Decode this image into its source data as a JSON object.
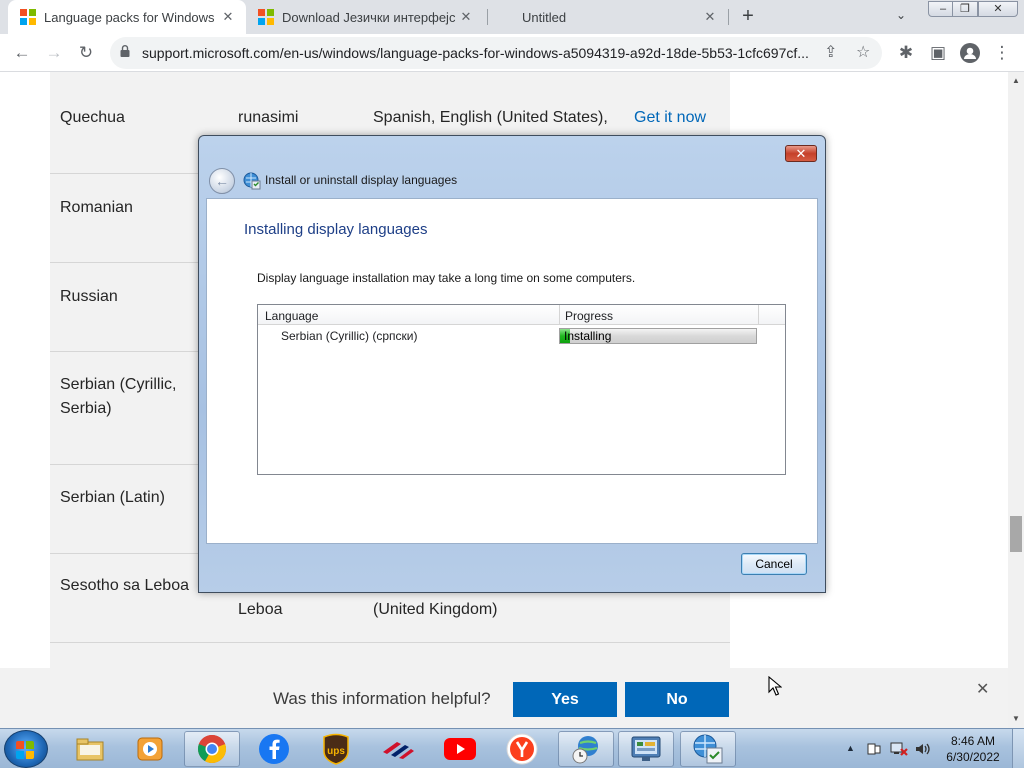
{
  "browser": {
    "tabs": [
      {
        "title": "Language packs for Windows",
        "close": "✕",
        "favicon": "microsoft-logo"
      },
      {
        "title": "Download Језички интерфејс па",
        "close": "✕",
        "favicon": "microsoft-logo"
      },
      {
        "title": "Untitled",
        "close": "✕",
        "favicon": "none"
      }
    ],
    "new_tab": "+",
    "tab_search": "⌄",
    "window_buttons": [
      "–",
      "❐",
      "✕"
    ],
    "nav": {
      "back": "←",
      "forward": "→",
      "reload": "↻"
    },
    "url": "support.microsoft.com/en-us/windows/language-packs-for-windows-a5094319-a92d-18de-5b53-1cfc697cf...",
    "toolbar_icons": {
      "share": "⇪",
      "star": "☆",
      "extensions": "✱",
      "sidepanel": "▣",
      "profile": "●",
      "menu": "⋮"
    }
  },
  "language_table": {
    "rows": [
      {
        "name": "Quechua",
        "native": "runasimi",
        "base": "Spanish, English (United States),",
        "action": "Get it now"
      },
      {
        "name": "Romanian",
        "native": "",
        "base": "",
        "action": ""
      },
      {
        "name": "Russian",
        "native": "",
        "base": "",
        "action": ""
      },
      {
        "name": "Serbian (Cyrillic, Serbia)",
        "native": "",
        "base": "",
        "action": ""
      },
      {
        "name": "Serbian (Latin)",
        "native": "",
        "base": "",
        "action": ""
      },
      {
        "name": "Sesotho sa Leboa",
        "native": "Leboa",
        "base": "(United Kingdom)",
        "action": ""
      }
    ]
  },
  "feedback": {
    "question": "Was this information helpful?",
    "yes": "Yes",
    "no": "No",
    "close": "✕"
  },
  "dialog": {
    "close": "✕",
    "back": "←",
    "title": "Install or uninstall display languages",
    "heading": "Installing display languages",
    "description": "Display language installation may take a long time on some computers.",
    "columns": [
      "Language",
      "Progress"
    ],
    "items": [
      {
        "language": "Serbian (Cyrillic) (српски)",
        "status": "Installing",
        "progress": 0.05
      }
    ],
    "cancel": "Cancel"
  },
  "taskbar": {
    "pinned": [
      "windows-explorer",
      "media-player",
      "chrome",
      "facebook",
      "ups",
      "bank-of-america",
      "youtube",
      "yandex",
      "globe-clock",
      "control-panel",
      "language-install"
    ],
    "clock_time": "8:46 AM",
    "clock_date": "6/30/2022",
    "tray": {
      "expand": "▲"
    }
  },
  "colors": {
    "ms_red": "#f25022",
    "ms_green": "#7fba00",
    "ms_blue": "#00a4ef",
    "ms_yellow": "#ffb900",
    "feedback_button": "#0067b8",
    "link": "#0067b8",
    "dialog_heading": "#1e3f87",
    "progress_green": "#1fb81f"
  }
}
